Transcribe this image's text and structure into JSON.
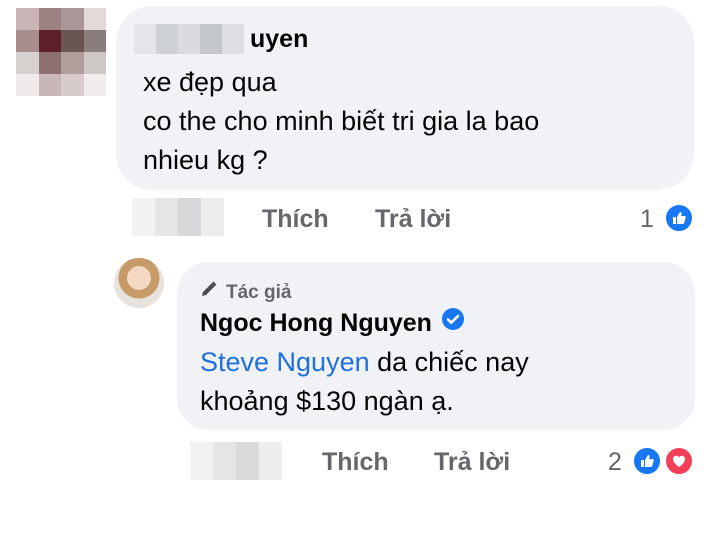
{
  "comment1": {
    "author_suffix": "uyen",
    "lines": [
      "xe đẹp qua",
      "co the cho minh biết tri gia la bao",
      "nhieu kg ?"
    ],
    "actions": {
      "like": "Thích",
      "reply": "Trả lời"
    },
    "reaction_count": "1"
  },
  "comment2": {
    "author_label": "Tác giả",
    "author_name": "Ngoc Hong Nguyen",
    "mention": "Steve Nguyen",
    "text_after_mention": " da chiếc nay",
    "line2": "khoảng $130 ngàn ạ.",
    "actions": {
      "like": "Thích",
      "reply": "Trả lời"
    },
    "reaction_count": "2"
  },
  "colors": {
    "bubble": "#f0f2f5",
    "muted": "#65676b",
    "mention": "#216fdb",
    "like": "#1877f2",
    "love": "#f33e58"
  },
  "icons": [
    "pixelated-avatar",
    "thumbs-up-icon",
    "heart-icon",
    "pencil-icon",
    "verified-badge-icon",
    "author-avatar"
  ]
}
